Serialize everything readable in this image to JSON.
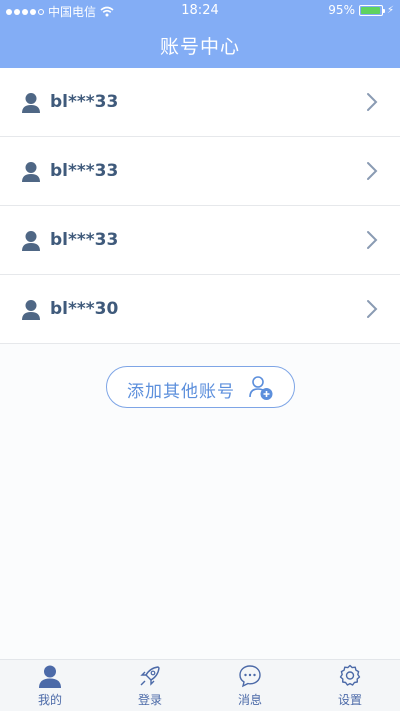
{
  "status_bar": {
    "carrier": "中国电信",
    "time": "18:24",
    "battery": "95%",
    "battery_level": 0.95
  },
  "header": {
    "title": "账号中心"
  },
  "accounts": [
    {
      "name": "bl***33"
    },
    {
      "name": "bl***33"
    },
    {
      "name": "bl***33"
    },
    {
      "name": "bl***30"
    }
  ],
  "add_button": {
    "label": "添加其他账号"
  },
  "tabs": [
    {
      "label": "我的",
      "icon": "person-icon",
      "active": true
    },
    {
      "label": "登录",
      "icon": "rocket-icon"
    },
    {
      "label": "消息",
      "icon": "chat-bubble-icon"
    },
    {
      "label": "设置",
      "icon": "gear-icon"
    }
  ],
  "colors": {
    "header_bg": "#83adf5",
    "accent": "#5c8fdc",
    "account_text": "#3f5a7b",
    "tab_text": "#4c6aa8"
  }
}
